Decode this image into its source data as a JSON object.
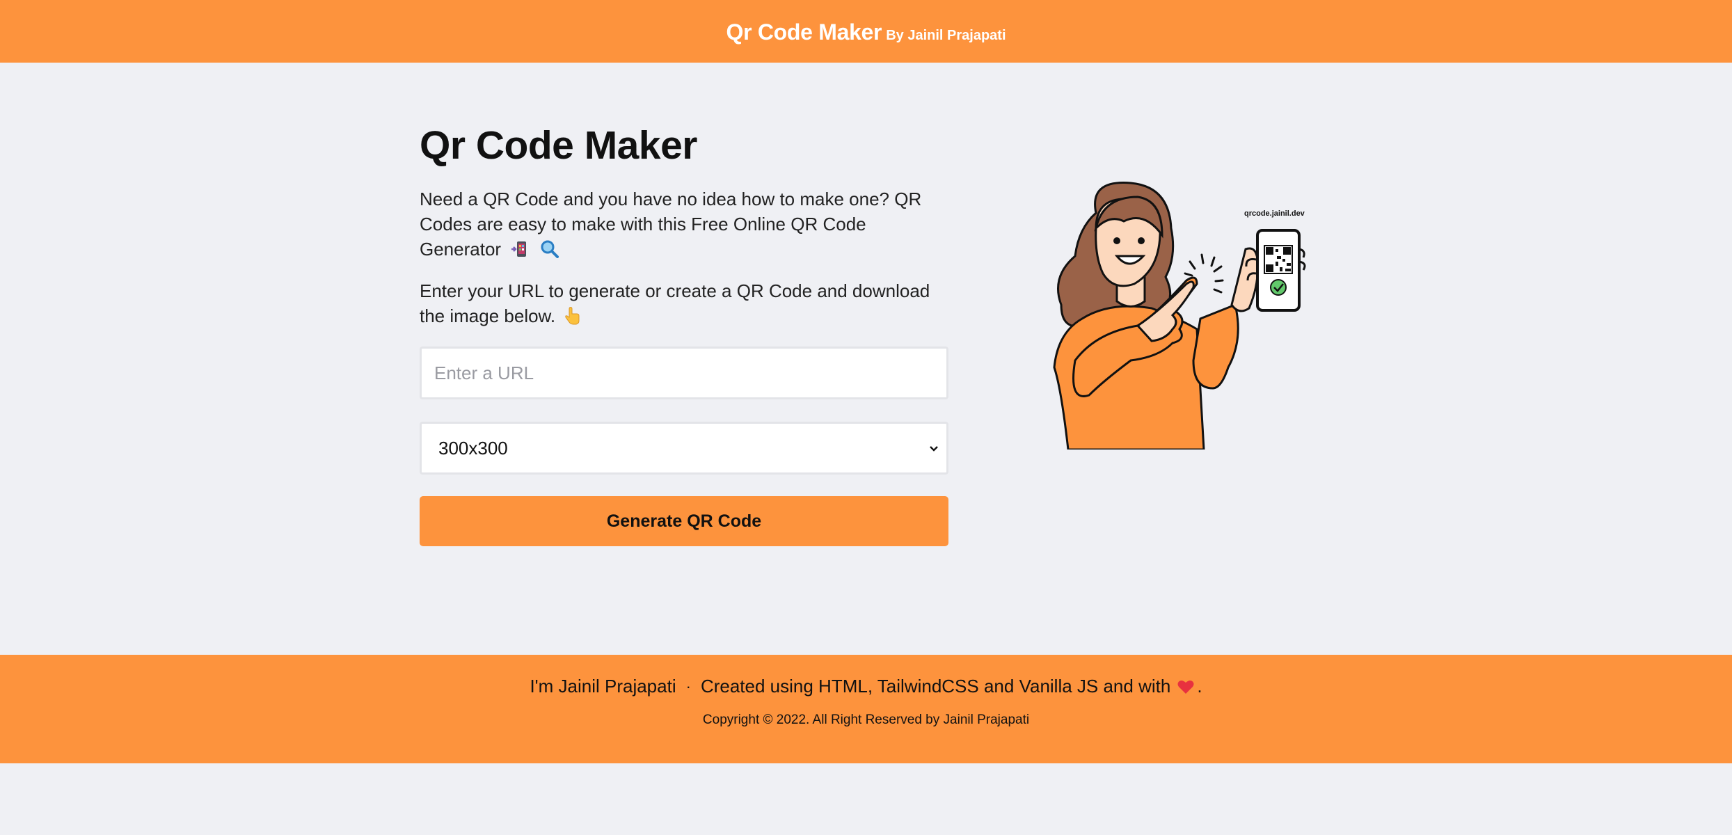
{
  "header": {
    "title": "Qr Code Maker",
    "by": "By Jainil Prajapati",
    "brand_color": "#fd933d"
  },
  "main": {
    "title": "Qr Code Maker",
    "description": "Need a QR Code and you have no idea how to make one? QR Codes are easy to make with this Free Online QR Code Generator",
    "description_icons": [
      "mobile-phone-icon",
      "magnifier-icon"
    ],
    "instructions": "Enter your URL to generate or create a QR Code and download the image below.",
    "instructions_icon": "pointing-down-icon",
    "url_input": {
      "placeholder": "Enter a URL",
      "value": ""
    },
    "size_select": {
      "selected": "300x300"
    },
    "generate_button": "Generate QR Code",
    "illustration": {
      "caption": "qrcode.jainil.dev"
    }
  },
  "footer": {
    "author": "I'm Jainil Prajapati",
    "separator": "·",
    "credits": "Created using HTML, TailwindCSS and Vanilla JS and with",
    "credits_end": ".",
    "credits_icon": "heart-icon",
    "copyright": "Copyright © 2022. All Right Reserved by Jainil Prajapati"
  },
  "colors": {
    "accent": "#fd933d",
    "background": "#eff0f4",
    "text": "#111111"
  }
}
